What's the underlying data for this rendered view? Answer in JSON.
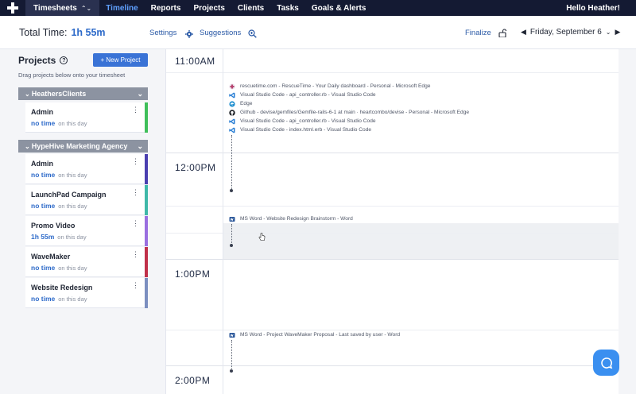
{
  "nav": {
    "timesheets": "Timesheets",
    "items": [
      "Timeline",
      "Reports",
      "Projects",
      "Clients",
      "Tasks",
      "Goals & Alerts"
    ],
    "user": "Hello Heather!"
  },
  "header": {
    "total_label": "Total Time:",
    "total_value": "1h 55m",
    "settings": "Settings",
    "suggestions": "Suggestions",
    "finalize": "Finalize",
    "date": "Friday, September 6"
  },
  "sidebar": {
    "title": "Projects",
    "new_project": "+ New Project",
    "hint": "Drag projects below onto your timesheet",
    "group1": "HeathersClients",
    "group2": "HypeHive Marketing Agency",
    "on_this_day": "on this day",
    "projects": [
      {
        "name": "Admin",
        "time": "no time",
        "color": "#3fbf5a"
      },
      {
        "name": "Admin",
        "time": "no time",
        "color": "#4a3fb0"
      },
      {
        "name": "LaunchPad Campaign",
        "time": "no time",
        "color": "#3fb8a8"
      },
      {
        "name": "Promo Video",
        "time": "1h 55m",
        "color": "#9a6fe0"
      },
      {
        "name": "WaveMaker",
        "time": "no time",
        "color": "#c0304a"
      },
      {
        "name": "Website Redesign",
        "time": "no time",
        "color": "#7c8fc0"
      }
    ]
  },
  "timeline": {
    "hours": [
      "11:00AM",
      "12:00PM",
      "1:00PM",
      "2:00PM"
    ],
    "entries": [
      {
        "icon": "rescuetime-icon",
        "text": "rescuetime.com - RescueTime - Your Daily dashboard - Personal - Microsoft Edge"
      },
      {
        "icon": "vscode-icon",
        "text": "Visual Studio Code - api_controller.rb - Visual Studio Code"
      },
      {
        "icon": "edge-icon",
        "text": "Edge"
      },
      {
        "icon": "github-icon",
        "text": "Github - devise/gemfiles/Gemfile-rails-6-1 at main · heartcombo/devise - Personal - Microsoft Edge"
      },
      {
        "icon": "vscode-icon",
        "text": "Visual Studio Code - api_controller.rb - Visual Studio Code"
      },
      {
        "icon": "vscode-icon",
        "text": "Visual Studio Code - index.html.erb - Visual Studio Code"
      },
      {
        "icon": "word-icon",
        "text": "MS Word - Website Redesign Brainstorm - Word"
      },
      {
        "icon": "word-icon",
        "text": "MS Word - Project WaveMaker Proposal - Last saved by user - Word"
      }
    ]
  }
}
